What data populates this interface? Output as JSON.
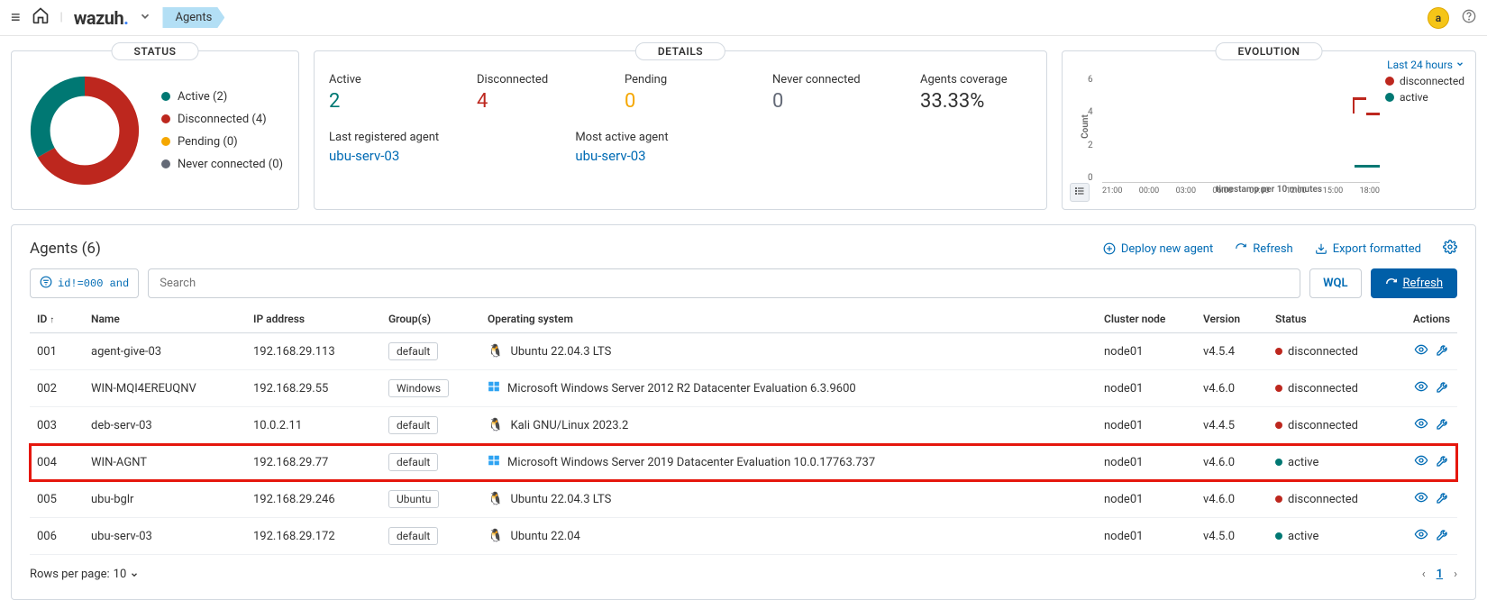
{
  "topbar": {
    "brand_main": "wazuh",
    "brand_dot": ".",
    "breadcrumb": "Agents",
    "avatar": "a"
  },
  "status_card": {
    "title": "STATUS",
    "legend": {
      "active": "Active (2)",
      "disconnected": "Disconnected (4)",
      "pending": "Pending (0)",
      "never": "Never connected (0)"
    },
    "counts": {
      "active": 2,
      "disconnected": 4,
      "pending": 0,
      "never": 0
    }
  },
  "details_card": {
    "title": "DETAILS",
    "active_label": "Active",
    "active_value": "2",
    "disconnected_label": "Disconnected",
    "disconnected_value": "4",
    "pending_label": "Pending",
    "pending_value": "0",
    "never_label": "Never connected",
    "never_value": "0",
    "coverage_label": "Agents coverage",
    "coverage_value": "33.33%",
    "last_registered_label": "Last registered agent",
    "last_registered_value": "ubu-serv-03",
    "most_active_label": "Most active agent",
    "most_active_value": "ubu-serv-03"
  },
  "evolution_card": {
    "title": "EVOLUTION",
    "range": "Last 24 hours",
    "legend_disconnected": "disconnected",
    "legend_active": "active",
    "ylabel": "Count",
    "xlabel": "timestamp per 10 minutes",
    "xticks": [
      "21:00",
      "00:00",
      "03:00",
      "06:00",
      "09:00",
      "12:00",
      "15:00",
      "18:00"
    ],
    "yticks": [
      "6",
      "4",
      "2",
      "0"
    ]
  },
  "chart_data": {
    "type": "line",
    "title": "EVOLUTION",
    "xlabel": "timestamp per 10 minutes",
    "ylabel": "Count",
    "ylim": [
      0,
      6
    ],
    "xticks": [
      "21:00",
      "00:00",
      "03:00",
      "06:00",
      "09:00",
      "12:00",
      "15:00",
      "18:00"
    ],
    "series": [
      {
        "name": "disconnected",
        "color": "#bd271e",
        "x": [
          "18:00",
          "18:30",
          "19:00"
        ],
        "values": [
          5,
          4,
          4
        ]
      },
      {
        "name": "active",
        "color": "#007873",
        "x": [
          "18:00",
          "18:30",
          "19:00"
        ],
        "values": [
          1,
          1,
          1
        ]
      }
    ],
    "note": "data only visible at far right of 24h window"
  },
  "agents_section": {
    "title": "Agents (6)",
    "deploy": "Deploy new agent",
    "refresh": "Refresh",
    "export": "Export formatted",
    "chip": "id!=000 and",
    "search_placeholder": "Search",
    "wql": "WQL",
    "refresh_btn": "Refresh"
  },
  "columns": {
    "id": "ID",
    "name": "Name",
    "ip": "IP address",
    "groups": "Group(s)",
    "os": "Operating system",
    "cluster": "Cluster node",
    "version": "Version",
    "status": "Status",
    "actions": "Actions"
  },
  "rows": [
    {
      "id": "001",
      "name": "agent-give-03",
      "ip": "192.168.29.113",
      "group": "default",
      "os": "Ubuntu 22.04.3 LTS",
      "os_type": "linux",
      "cluster": "node01",
      "version": "v4.5.4",
      "status": "disconnected"
    },
    {
      "id": "002",
      "name": "WIN-MQI4EREUQNV",
      "ip": "192.168.29.55",
      "group": "Windows",
      "os": "Microsoft Windows Server 2012 R2 Datacenter Evaluation 6.3.9600",
      "os_type": "windows",
      "cluster": "node01",
      "version": "v4.6.0",
      "status": "disconnected"
    },
    {
      "id": "003",
      "name": "deb-serv-03",
      "ip": "10.0.2.11",
      "group": "default",
      "os": "Kali GNU/Linux 2023.2",
      "os_type": "linux",
      "cluster": "node01",
      "version": "v4.4.5",
      "status": "disconnected"
    },
    {
      "id": "004",
      "name": "WIN-AGNT",
      "ip": "192.168.29.77",
      "group": "default",
      "os": "Microsoft Windows Server 2019 Datacenter Evaluation 10.0.17763.737",
      "os_type": "windows",
      "cluster": "node01",
      "version": "v4.6.0",
      "status": "active",
      "highlight": true
    },
    {
      "id": "005",
      "name": "ubu-bglr",
      "ip": "192.168.29.246",
      "group": "Ubuntu",
      "os": "Ubuntu 22.04.3 LTS",
      "os_type": "linux",
      "cluster": "node01",
      "version": "v4.6.0",
      "status": "disconnected"
    },
    {
      "id": "006",
      "name": "ubu-serv-03",
      "ip": "192.168.29.172",
      "group": "default",
      "os": "Ubuntu 22.04",
      "os_type": "linux",
      "cluster": "node01",
      "version": "v4.5.0",
      "status": "active"
    }
  ],
  "footer": {
    "rows_per_page_label": "Rows per page:",
    "rows_per_page_value": "10",
    "page": "1"
  }
}
